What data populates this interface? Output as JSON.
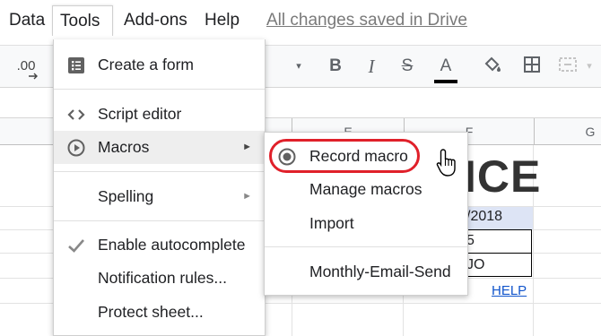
{
  "menubar": {
    "items": [
      "Data",
      "Tools",
      "Add-ons",
      "Help"
    ],
    "status": "All changes saved in Drive"
  },
  "toolbar": {
    "decimal_label": ".00",
    "bold": "B",
    "italic": "I",
    "strike": "S",
    "text_color": "A"
  },
  "sheet": {
    "columns": [
      "E",
      "F",
      "G"
    ],
    "cells": {
      "title_partial": "ICE",
      "date_partial": "/2018",
      "row2": "5",
      "row3": "JO",
      "help_link": "HELP"
    }
  },
  "tools_menu": {
    "items": [
      {
        "label": "Create a form",
        "icon": "form-icon"
      },
      {
        "label": "Script editor",
        "icon": "code-icon"
      },
      {
        "label": "Macros",
        "icon": "play-circle-icon",
        "submenu": true,
        "highlighted": true
      },
      {
        "label": "Spelling",
        "submenu": true
      },
      {
        "label": "Enable autocomplete",
        "icon": "checkmark-icon",
        "checked": true
      },
      {
        "label": "Notification rules..."
      },
      {
        "label": "Protect sheet..."
      }
    ]
  },
  "macros_submenu": {
    "items": [
      {
        "label": "Record macro",
        "icon": "record-icon",
        "circled": true
      },
      {
        "label": "Manage macros"
      },
      {
        "label": "Import"
      },
      {
        "label": "Monthly-Email-Send"
      }
    ]
  },
  "colors": {
    "accent_red": "#e0202a",
    "link_blue": "#1155cc",
    "date_fill": "#dde4f5"
  }
}
